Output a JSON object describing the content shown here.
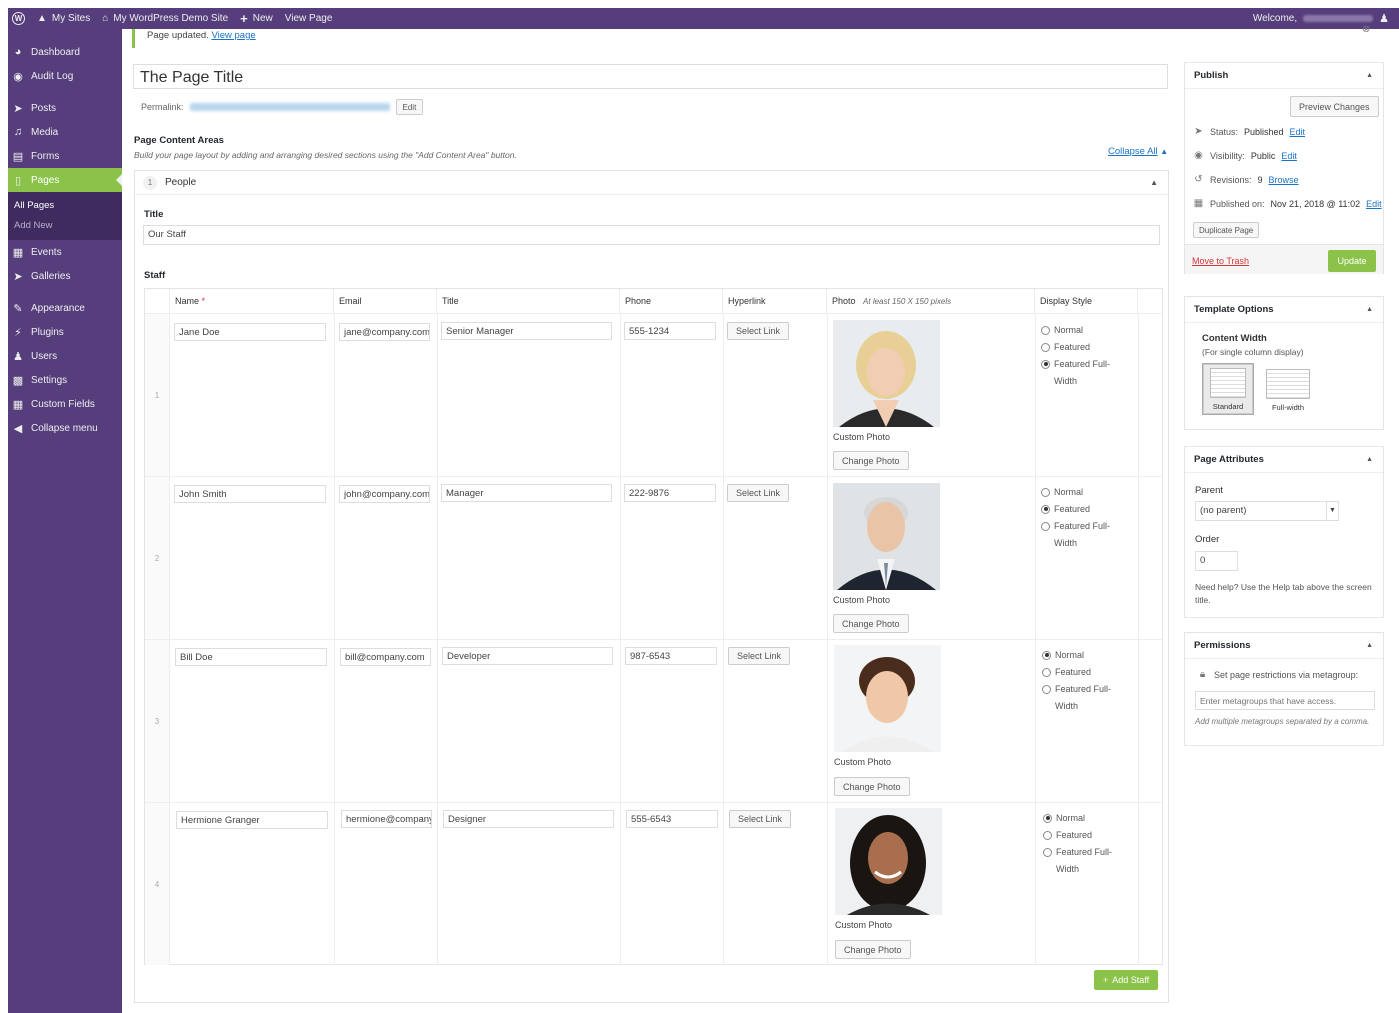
{
  "adminbar": {
    "my_sites": "My Sites",
    "site_name": "My WordPress Demo Site",
    "new": "New",
    "view_page": "View Page",
    "welcome": "Welcome,"
  },
  "sidebar": {
    "items": [
      {
        "label": "Dashboard",
        "icon": "dashboard-icon"
      },
      {
        "label": "Audit Log",
        "icon": "shield-icon"
      },
      {
        "label": "Posts",
        "icon": "pin-icon"
      },
      {
        "label": "Media",
        "icon": "media-icon"
      },
      {
        "label": "Forms",
        "icon": "forms-icon"
      },
      {
        "label": "Pages",
        "icon": "pages-icon"
      },
      {
        "label": "Events",
        "icon": "calendar-icon"
      },
      {
        "label": "Galleries",
        "icon": "pin-icon"
      },
      {
        "label": "Appearance",
        "icon": "brush-icon"
      },
      {
        "label": "Plugins",
        "icon": "plug-icon"
      },
      {
        "label": "Users",
        "icon": "user-icon"
      },
      {
        "label": "Settings",
        "icon": "settings-icon"
      },
      {
        "label": "Custom Fields",
        "icon": "table-icon"
      },
      {
        "label": "Collapse menu",
        "icon": "collapse-icon"
      }
    ],
    "submenu": {
      "all_pages": "All Pages",
      "add_new": "Add New"
    }
  },
  "notice": {
    "text": "Page updated.",
    "link": "View page"
  },
  "editor": {
    "title": "The Page Title",
    "permalink_label": "Permalink:",
    "edit": "Edit",
    "pca_title": "Page Content Areas",
    "pca_desc": "Build your page layout by adding and arranging desired sections using the \"Add Content Area\" button.",
    "collapse_all": "Collapse All"
  },
  "area": {
    "number": "1",
    "name": "People",
    "title_label": "Title",
    "title_value": "Our Staff",
    "staff_label": "Staff"
  },
  "table": {
    "headers": {
      "name": "Name",
      "required": "*",
      "email": "Email",
      "title": "Title",
      "phone": "Phone",
      "hyperlink": "Hyperlink",
      "photo": "Photo",
      "photo_hint": "At least 150 X 150 pixels",
      "display": "Display Style"
    },
    "select_link": "Select Link",
    "custom_photo": "Custom Photo",
    "change_photo": "Change Photo",
    "style_normal": "Normal",
    "style_featured": "Featured",
    "style_full": "Featured Full-Width",
    "rows": [
      {
        "num": "1",
        "name": "Jane Doe",
        "email": "jane@company.com",
        "title": "Senior Manager",
        "phone": "555-1234",
        "style": "full"
      },
      {
        "num": "2",
        "name": "John Smith",
        "email": "john@company.com",
        "title": "Manager",
        "phone": "222-9876",
        "style": "featured"
      },
      {
        "num": "3",
        "name": "Bill Doe",
        "email": "bill@company.com",
        "title": "Developer",
        "phone": "987-6543",
        "style": "normal"
      },
      {
        "num": "4",
        "name": "Hermione Granger",
        "email": "hermione@company.com",
        "title": "Designer",
        "phone": "555-6543",
        "style": "normal"
      }
    ],
    "add_staff": "Add Staff"
  },
  "publish": {
    "title": "Publish",
    "preview": "Preview Changes",
    "status_label": "Status:",
    "status_value": "Published",
    "visibility_label": "Visibility:",
    "visibility_value": "Public",
    "revisions_label": "Revisions:",
    "revisions_value": "9",
    "browse": "Browse",
    "published_label": "Published on:",
    "published_value": "Nov 21, 2018 @ 11:02",
    "edit": "Edit",
    "duplicate": "Duplicate Page",
    "trash": "Move to Trash",
    "update": "Update"
  },
  "template": {
    "title": "Template Options",
    "content_width": "Content Width",
    "hint": "(For single column display)",
    "standard": "Standard",
    "full": "Full-width"
  },
  "attributes": {
    "title": "Page Attributes",
    "parent_label": "Parent",
    "parent_value": "(no parent)",
    "order_label": "Order",
    "order_value": "0",
    "help": "Need help? Use the Help tab above the screen title."
  },
  "permissions": {
    "title": "Permissions",
    "label": "Set page restrictions via metagroup:",
    "placeholder": "Enter metagroups that have access.",
    "hint": "Add multiple metagroups separated by a comma."
  },
  "colors": {
    "brand": "#563d7c",
    "accent": "#8bc34a",
    "link": "#1a73c8"
  }
}
